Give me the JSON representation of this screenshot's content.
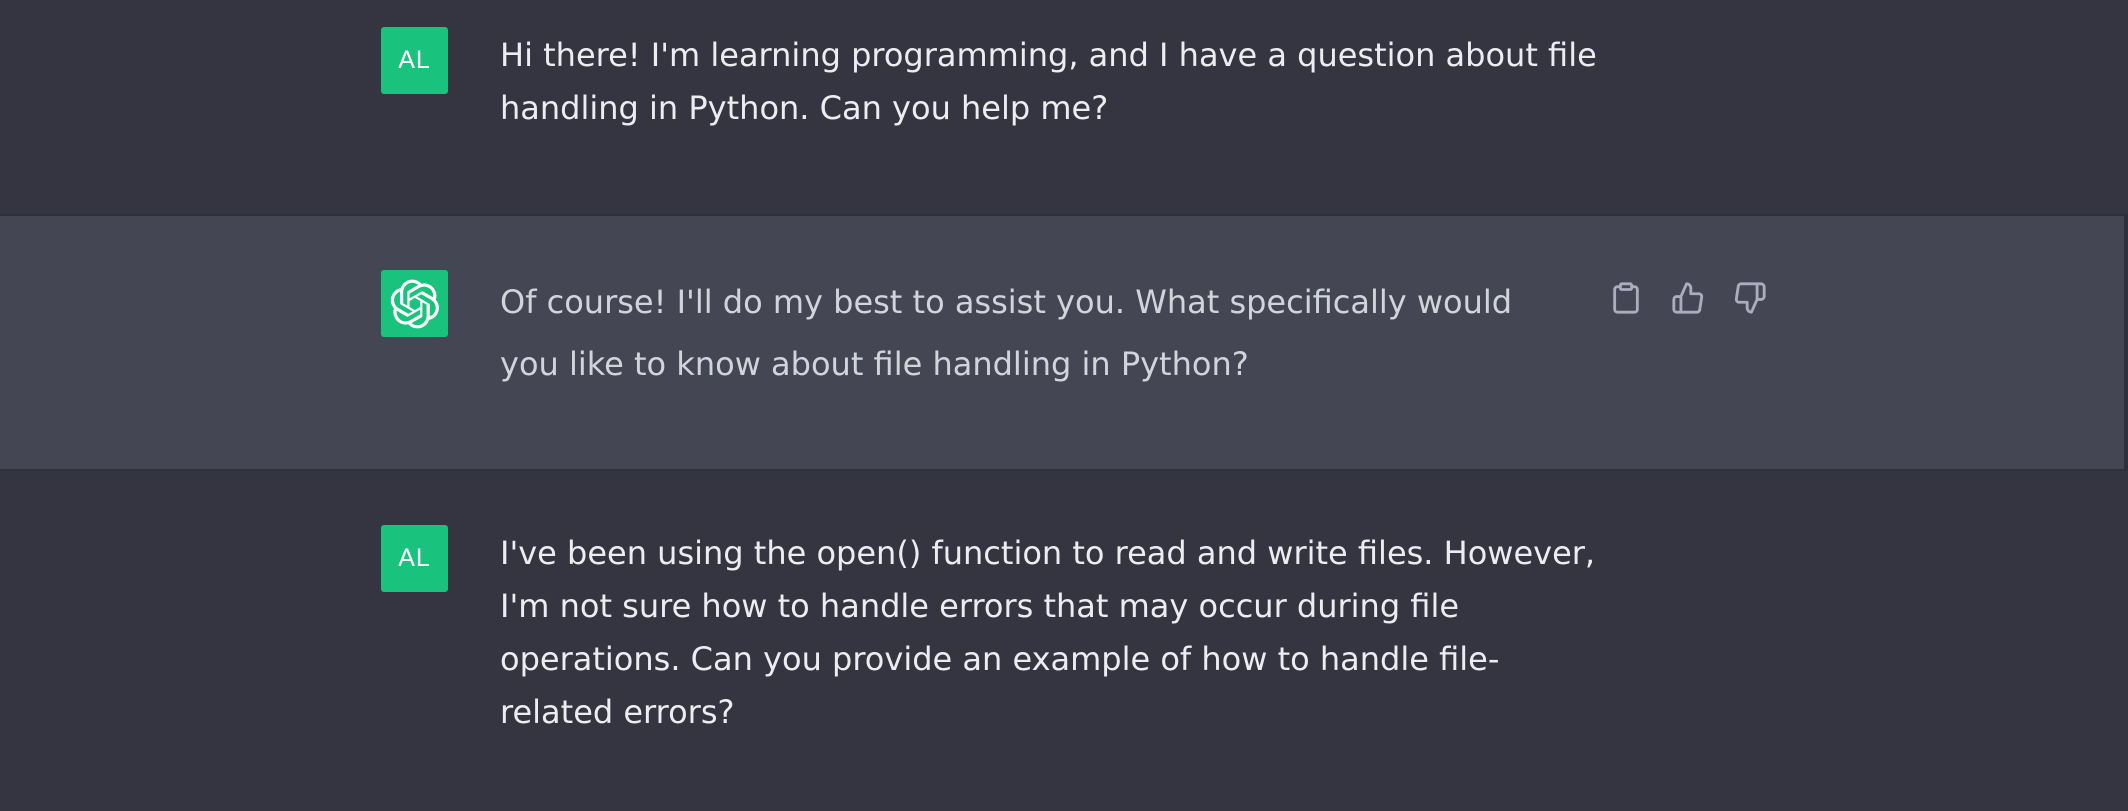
{
  "conversation": {
    "messages": [
      {
        "role": "user",
        "avatar_initials": "AL",
        "text": "Hi there! I'm learning programming, and I have a question about file handling in Python. Can you help me?"
      },
      {
        "role": "assistant",
        "avatar_icon": "openai-logo-icon",
        "text": "Of course! I'll do my best to assist you. What specifically would you like to know about file handling in Python?",
        "actions": [
          "clipboard-icon",
          "thumbs-up-icon",
          "thumbs-down-icon"
        ]
      },
      {
        "role": "user",
        "avatar_initials": "AL",
        "text": "I've been using the open() function to read and write files. However, I'm not sure how to handle errors that may occur during file operations. Can you provide an example of how to handle file-related errors?"
      }
    ]
  },
  "colors": {
    "user_background": "#343541",
    "assistant_background": "#444654",
    "avatar_green": "#19c37d",
    "user_text": "#ececf1",
    "assistant_text": "#d1d5db",
    "icon_gray": "#acacbe"
  }
}
